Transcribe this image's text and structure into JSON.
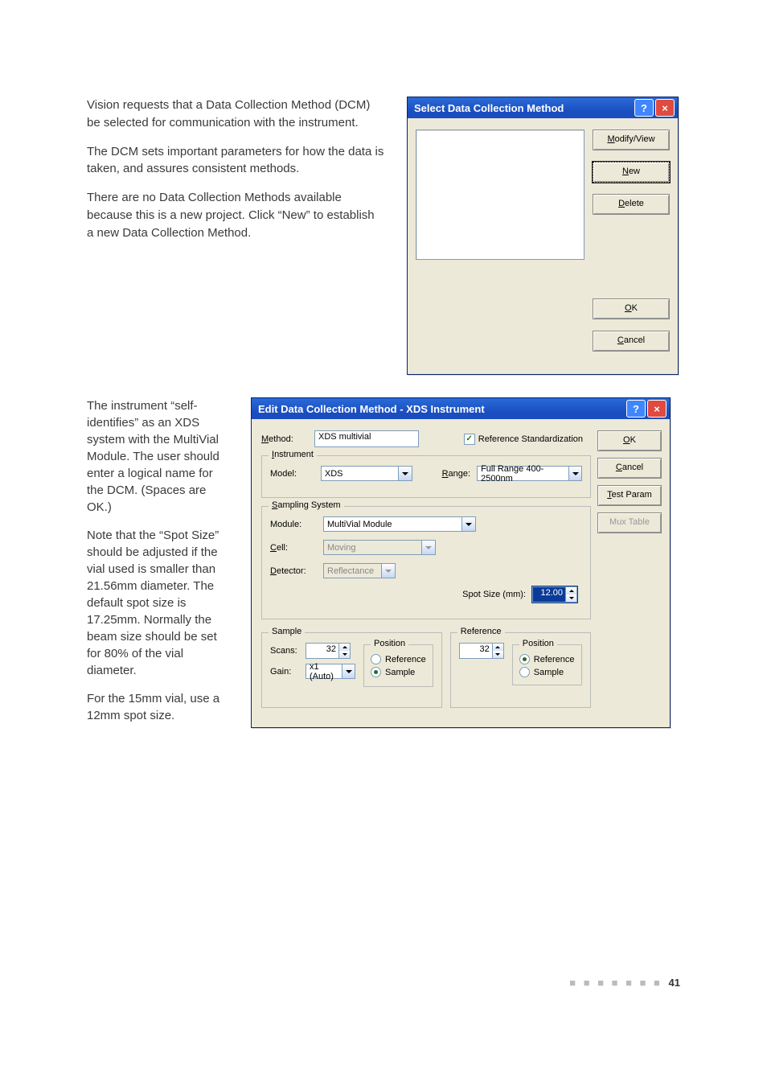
{
  "paragraphs": {
    "p1": "Vision requests that a Data Collection Method (DCM) be selected for communication with the instrument.",
    "p2": "The DCM sets important parameters for how the data is taken, and assures consistent methods.",
    "p3": "There are no Data Collection Methods available because this is a new project. Click “New” to establish a new Data Collection Method.",
    "p4": "The instrument “self-identifies” as an XDS system with the MultiVial Module. The user should enter a logical name for the DCM. (Spaces are OK.)",
    "p5": "Note that the “Spot Size” should be adjusted if the vial used is smaller than 21.56mm diameter. The default spot size is 17.25mm. Normally the beam size should be set for 80% of the vial diameter.",
    "p6": "For the 15mm vial, use a 12mm spot size."
  },
  "dlg1": {
    "title": "Select Data Collection Method",
    "buttons": {
      "modify": "Modify/View",
      "new": "New",
      "delete": "Delete",
      "ok": "OK",
      "cancel": "Cancel"
    }
  },
  "dlg2": {
    "title": "Edit Data Collection Method - XDS Instrument",
    "labels": {
      "method": "Method:",
      "ref_std": "Reference Standardization",
      "instrument": "Instrument",
      "model": "Model:",
      "range": "Range:",
      "sampling_system": "Sampling System",
      "module": "Module:",
      "cell": "Cell:",
      "detector": "Detector:",
      "spot_size": "Spot Size (mm):",
      "sample": "Sample",
      "reference": "Reference",
      "position": "Position",
      "scans": "Scans:",
      "gain": "Gain:",
      "pos_reference": "Reference",
      "pos_sample": "Sample"
    },
    "values": {
      "method": "XDS multivial",
      "model": "XDS",
      "range": "Full Range 400-2500nm",
      "module": "MultiVial Module",
      "cell": "Moving",
      "detector": "Reflectance",
      "spot_size": "12.00",
      "sample_scans": "32",
      "gain": "x1 (Auto)",
      "reference_scans": "32"
    },
    "buttons": {
      "ok": "OK",
      "cancel": "Cancel",
      "test": "Test Param",
      "mux": "Mux Table"
    },
    "ref_std_checked": "✓"
  },
  "footer": {
    "dots": "■ ■ ■ ■ ■ ■ ■",
    "page": "41"
  }
}
